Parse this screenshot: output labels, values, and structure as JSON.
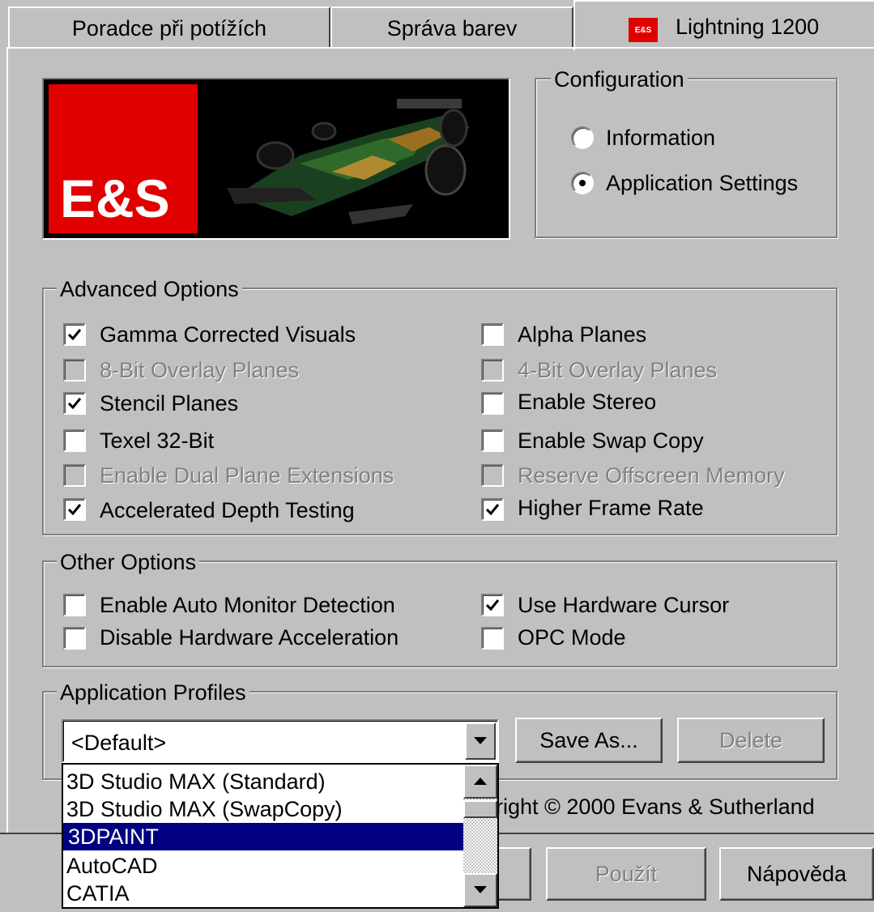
{
  "tabs": [
    {
      "label": "Poradce při potížích"
    },
    {
      "label": "Správa barev"
    },
    {
      "label": "Lightning 1200",
      "icon": "es-logo-icon"
    }
  ],
  "logo": {
    "text": "E&S",
    "color": "#e00000"
  },
  "configuration": {
    "title": "Configuration",
    "options": [
      {
        "label": "Information",
        "selected": false
      },
      {
        "label": "Application Settings",
        "selected": true
      }
    ]
  },
  "advanced_options": {
    "title": "Advanced Options",
    "left": [
      {
        "label": "Gamma Corrected Visuals",
        "checked": true,
        "enabled": true
      },
      {
        "label": "8-Bit Overlay Planes",
        "checked": false,
        "enabled": false
      },
      {
        "label": "Stencil Planes",
        "checked": true,
        "enabled": true
      },
      {
        "label": "Texel 32-Bit",
        "checked": false,
        "enabled": true
      },
      {
        "label": "Enable Dual Plane Extensions",
        "checked": false,
        "enabled": false
      },
      {
        "label": "Accelerated Depth Testing",
        "checked": true,
        "enabled": true
      }
    ],
    "right": [
      {
        "label": "Alpha Planes",
        "checked": false,
        "enabled": true
      },
      {
        "label": "4-Bit Overlay Planes",
        "checked": false,
        "enabled": false
      },
      {
        "label": "Enable Stereo",
        "checked": false,
        "enabled": true
      },
      {
        "label": "Enable Swap Copy",
        "checked": false,
        "enabled": true
      },
      {
        "label": "Reserve Offscreen Memory",
        "checked": false,
        "enabled": false
      },
      {
        "label": "Higher Frame Rate",
        "checked": true,
        "enabled": true
      }
    ]
  },
  "other_options": {
    "title": "Other Options",
    "left": [
      {
        "label": "Enable Auto Monitor Detection",
        "checked": false
      },
      {
        "label": "Disable Hardware Acceleration",
        "checked": false
      }
    ],
    "right": [
      {
        "label": "Use Hardware Cursor",
        "checked": true
      },
      {
        "label": "OPC Mode",
        "checked": false
      }
    ]
  },
  "application_profiles": {
    "title": "Application Profiles",
    "selected_value": "<Default>",
    "save_as_label": "Save As...",
    "delete_label": "Delete",
    "dropdown_items": [
      "3D Studio MAX (Standard)",
      "3D Studio MAX (SwapCopy)",
      "3DPAINT",
      "AutoCAD",
      "CATIA"
    ],
    "highlighted_item": "3DPAINT"
  },
  "copyright": "right © 2000 Evans & Sutherland",
  "bottom_buttons": {
    "apply_label": "Použít",
    "help_label": "Nápověda"
  },
  "colors": {
    "window_bg": "#c0c0c0",
    "selection": "#000080",
    "brand_red": "#e00000"
  }
}
